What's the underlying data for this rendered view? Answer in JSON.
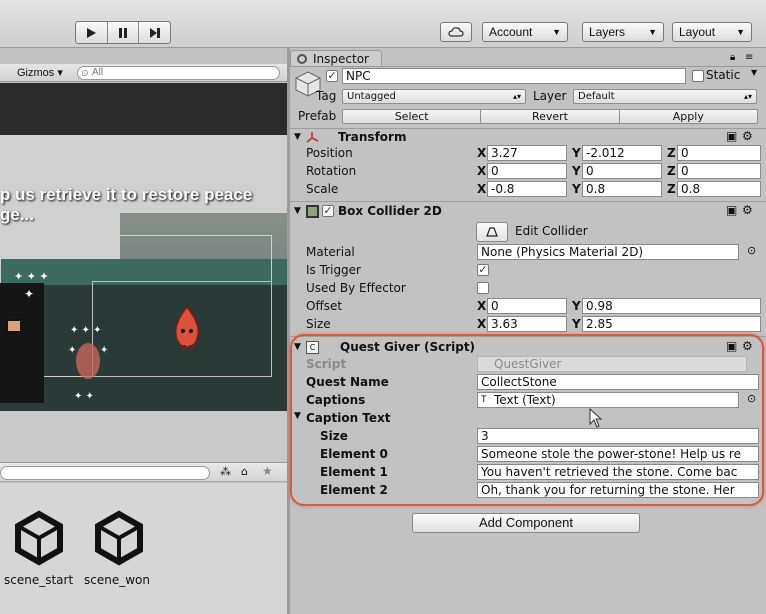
{
  "toolbar": {
    "play_icon": "play-icon",
    "pause_icon": "pause-icon",
    "step_icon": "step-icon",
    "cloud_icon": "cloud-icon",
    "account_label": "Account",
    "layers_label": "Layers",
    "layout_label": "Layout"
  },
  "scene": {
    "gizmos_label": "Gizmos",
    "search_placeholder": "All",
    "headline_line1": "p us retrieve it to restore peace",
    "headline_line2": "ge..."
  },
  "project": {
    "assets": [
      {
        "label": "scene_start",
        "icon": "unity-scene-icon"
      },
      {
        "label": "scene_won",
        "icon": "unity-scene-icon"
      }
    ]
  },
  "inspector": {
    "tab_label": "Inspector",
    "object_name": "NPC",
    "static_label": "Static",
    "tag_label": "Tag",
    "tag_value": "Untagged",
    "layer_label": "Layer",
    "layer_value": "Default",
    "prefab_label": "Prefab",
    "prefab_buttons": [
      "Select",
      "Revert",
      "Apply"
    ],
    "transform": {
      "title": "Transform",
      "rows": [
        {
          "label": "Position",
          "x": "3.27",
          "y": "-2.012",
          "z": "0"
        },
        {
          "label": "Rotation",
          "x": "0",
          "y": "0",
          "z": "0"
        },
        {
          "label": "Scale",
          "x": "-0.8",
          "y": "0.8",
          "z": "0.8"
        }
      ],
      "axis_x": "X",
      "axis_y": "Y",
      "axis_z": "Z"
    },
    "box_collider": {
      "title": "Box Collider 2D",
      "edit_collider_label": "Edit Collider",
      "material_label": "Material",
      "material_value": "None (Physics Material 2D)",
      "is_trigger_label": "Is Trigger",
      "is_trigger_checked": true,
      "used_by_effector_label": "Used By Effector",
      "used_by_effector_checked": false,
      "offset_label": "Offset",
      "offset_x": "0",
      "offset_y": "0.98",
      "size_label": "Size",
      "size_x": "3.63",
      "size_y": "2.85"
    },
    "quest_giver": {
      "title": "Quest Giver (Script)",
      "script_label": "Script",
      "script_value": "QuestGiver",
      "quest_name_label": "Quest Name",
      "quest_name_value": "CollectStone",
      "captions_label": "Captions",
      "captions_value": "Text (Text)",
      "caption_text_label": "Caption Text",
      "size_label": "Size",
      "size_value": "3",
      "elements": [
        {
          "label": "Element 0",
          "value": "Someone stole the power-stone! Help us re"
        },
        {
          "label": "Element 1",
          "value": "You haven't retrieved the stone. Come bac"
        },
        {
          "label": "Element 2",
          "value": "Oh, thank you for returning the stone. Her"
        }
      ]
    },
    "add_component_label": "Add Component",
    "accent_color": "#d65a3c"
  }
}
